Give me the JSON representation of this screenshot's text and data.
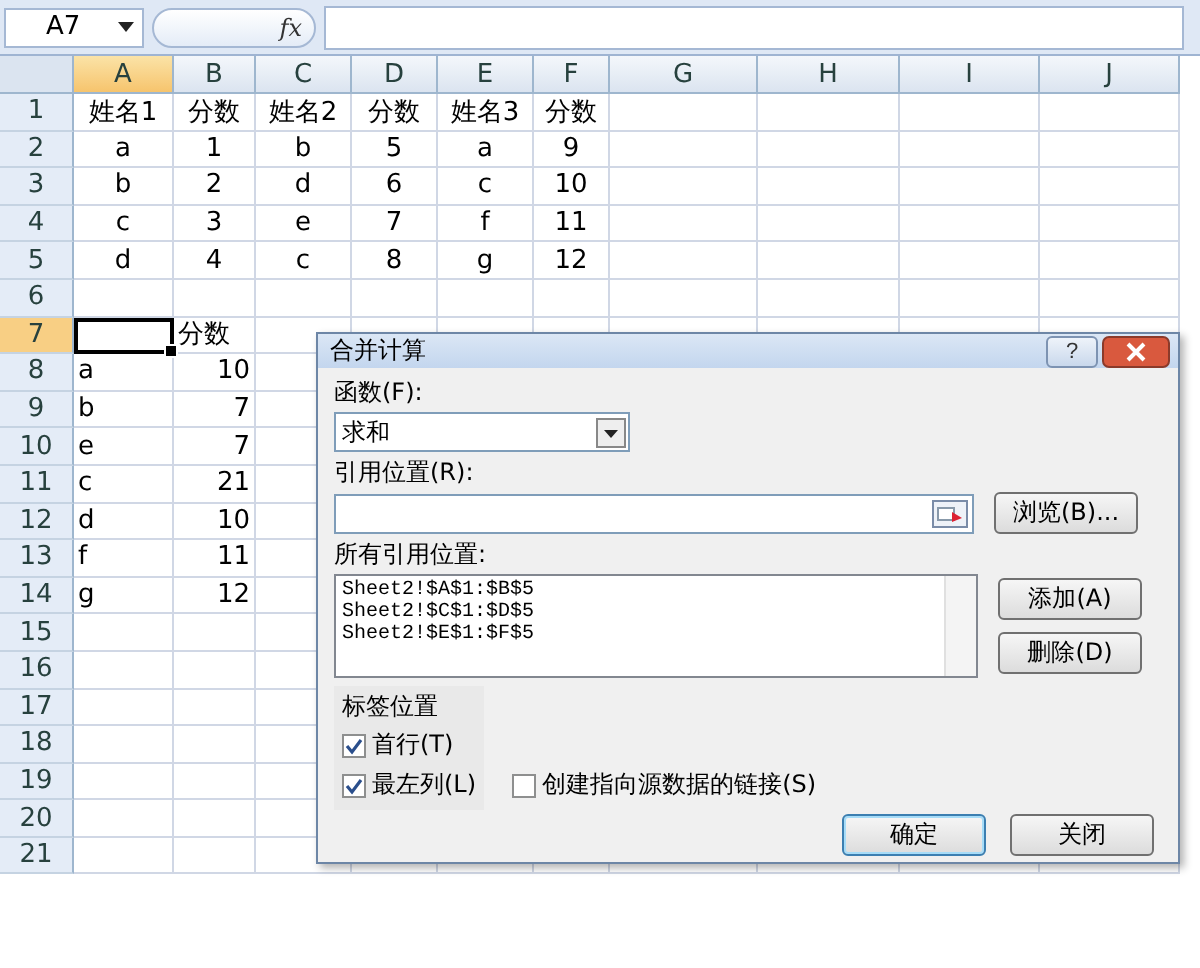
{
  "name_box": "A7",
  "function_button": "fx",
  "columns": [
    {
      "label": "A",
      "selected": true
    },
    {
      "label": "B",
      "selected": false
    },
    {
      "label": "C",
      "selected": false
    },
    {
      "label": "D",
      "selected": false
    },
    {
      "label": "E",
      "selected": false
    },
    {
      "label": "F",
      "selected": false
    },
    {
      "label": "G",
      "selected": false
    },
    {
      "label": "H",
      "selected": false
    },
    {
      "label": "I",
      "selected": false
    },
    {
      "label": "J",
      "selected": false
    }
  ],
  "rows": [
    {
      "label": "1",
      "selected": false,
      "centered": true,
      "cells": [
        "姓名1",
        "分数",
        "姓名2",
        "分数",
        "姓名3",
        "分数"
      ]
    },
    {
      "label": "2",
      "selected": false,
      "centered": true,
      "cells": [
        "a",
        "1",
        "b",
        "5",
        "a",
        "9"
      ]
    },
    {
      "label": "3",
      "selected": false,
      "centered": true,
      "cells": [
        "b",
        "2",
        "d",
        "6",
        "c",
        "10"
      ]
    },
    {
      "label": "4",
      "selected": false,
      "centered": true,
      "cells": [
        "c",
        "3",
        "e",
        "7",
        "f",
        "11"
      ]
    },
    {
      "label": "5",
      "selected": false,
      "centered": true,
      "cells": [
        "d",
        "4",
        "c",
        "8",
        "g",
        "12"
      ]
    },
    {
      "label": "6",
      "selected": false,
      "centered": false,
      "cells": []
    },
    {
      "label": "7",
      "selected": true,
      "centered": false,
      "cells": [
        null,
        "分数"
      ]
    },
    {
      "label": "8",
      "selected": false,
      "centered": false,
      "cells": [
        "a",
        "10"
      ]
    },
    {
      "label": "9",
      "selected": false,
      "centered": false,
      "cells": [
        "b",
        "7"
      ]
    },
    {
      "label": "10",
      "selected": false,
      "centered": false,
      "cells": [
        "e",
        "7"
      ]
    },
    {
      "label": "11",
      "selected": false,
      "centered": false,
      "cells": [
        "c",
        "21"
      ]
    },
    {
      "label": "12",
      "selected": false,
      "centered": false,
      "cells": [
        "d",
        "10"
      ]
    },
    {
      "label": "13",
      "selected": false,
      "centered": false,
      "cells": [
        "f",
        "11"
      ]
    },
    {
      "label": "14",
      "selected": false,
      "centered": false,
      "cells": [
        "g",
        "12"
      ]
    },
    {
      "label": "15",
      "selected": false,
      "centered": false,
      "cells": []
    },
    {
      "label": "16",
      "selected": false,
      "centered": false,
      "cells": []
    },
    {
      "label": "17",
      "selected": false,
      "centered": false,
      "cells": []
    },
    {
      "label": "18",
      "selected": false,
      "centered": false,
      "cells": []
    },
    {
      "label": "19",
      "selected": false,
      "centered": false,
      "cells": []
    },
    {
      "label": "20",
      "selected": false,
      "centered": false,
      "cells": []
    },
    {
      "label": "21",
      "selected": false,
      "centered": false,
      "cells": []
    }
  ],
  "dialog": {
    "title": "合并计算",
    "help_button": "?",
    "function_label": "函数(F):",
    "function_value": "求和",
    "reference_label": "引用位置(R):",
    "browse_button": "浏览(B)...",
    "all_references_label": "所有引用位置:",
    "references": [
      {
        "text": "Sheet2!$A$1:$B$5",
        "selected": false
      },
      {
        "text": "Sheet2!$C$1:$D$5",
        "selected": false
      },
      {
        "text": "Sheet2!$E$1:$F$5",
        "selected": false
      }
    ],
    "add_button": "添加(A)",
    "delete_button": "删除(D)",
    "label_group": "标签位置",
    "options": [
      {
        "label": "首行(T)",
        "checked": true,
        "grouped": true
      },
      {
        "label": "最左列(L)",
        "checked": true,
        "grouped": true
      },
      {
        "label": "创建指向源数据的链接(S)",
        "checked": false,
        "grouped": false
      }
    ],
    "buttons": [
      {
        "label": "确定",
        "default": true
      },
      {
        "label": "关闭",
        "default": false
      }
    ]
  }
}
